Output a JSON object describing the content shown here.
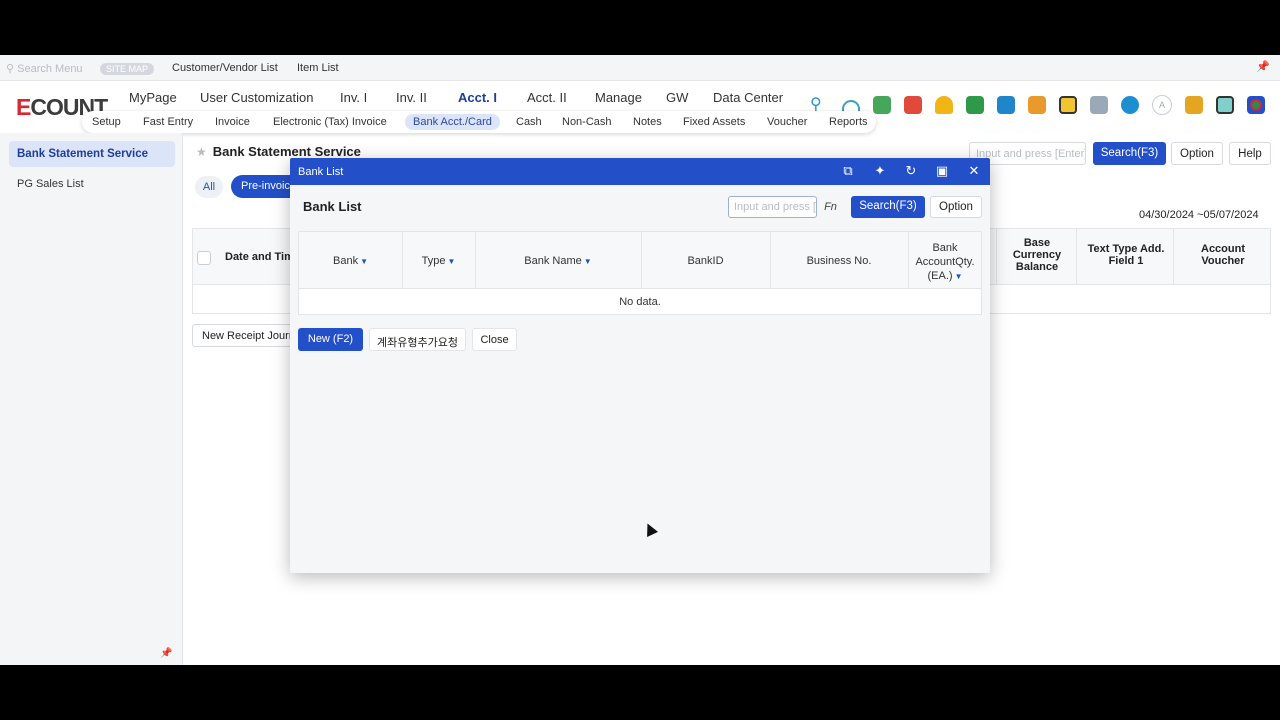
{
  "topbar": {
    "search_placeholder": "Search Menu",
    "sitemap": "SITE MAP",
    "links": [
      "Customer/Vendor List",
      "Item List"
    ]
  },
  "logo": {
    "e": "E",
    "rest": "COUNT"
  },
  "main_nav": [
    "MyPage",
    "User Customization",
    "Inv. I",
    "Inv. II",
    "Acct. I",
    "Acct. II",
    "Manage",
    "GW",
    "Data Center"
  ],
  "main_nav_active": "Acct. I",
  "sub_nav": [
    "Setup",
    "Fast Entry",
    "Invoice",
    "Electronic (Tax) Invoice",
    "Bank Acct./Card",
    "Cash",
    "Non-Cash",
    "Notes",
    "Fixed Assets",
    "Voucher",
    "Reports"
  ],
  "sub_nav_active": "Bank Acct./Card",
  "sidebar": {
    "items": [
      "Bank Statement Service",
      "PG Sales List"
    ]
  },
  "page": {
    "title": "Bank Statement Service",
    "search_placeholder": "Input and press [Enter]",
    "search_btn": "Search(F3)",
    "option_btn": "Option",
    "help_btn": "Help",
    "tab_all": "All",
    "tab_pre": "Pre-invoice",
    "date_range": "04/30/2024 ~05/07/2024",
    "columns": [
      "Date and Time",
      "Base Currency Balance",
      "Text Type Add. Field 1",
      "Account Voucher"
    ],
    "new_receipt_btn": "New Receipt Journal"
  },
  "modal": {
    "window_title": "Bank List",
    "title": "Bank List",
    "search_placeholder": "Input and press [Enter]",
    "fn_label": "Fn",
    "search_btn": "Search(F3)",
    "option_btn": "Option",
    "columns": [
      "Bank",
      "Type",
      "Bank Name",
      "BankID",
      "Business No.",
      "Bank AccountQty.(EA.)"
    ],
    "empty_text": "No data.",
    "new_btn": "New (F2)",
    "request_btn": "계좌유형추가요청",
    "close_btn": "Close"
  },
  "colors": {
    "brand_blue": "#2350c8",
    "logo_red": "#d8272e"
  }
}
